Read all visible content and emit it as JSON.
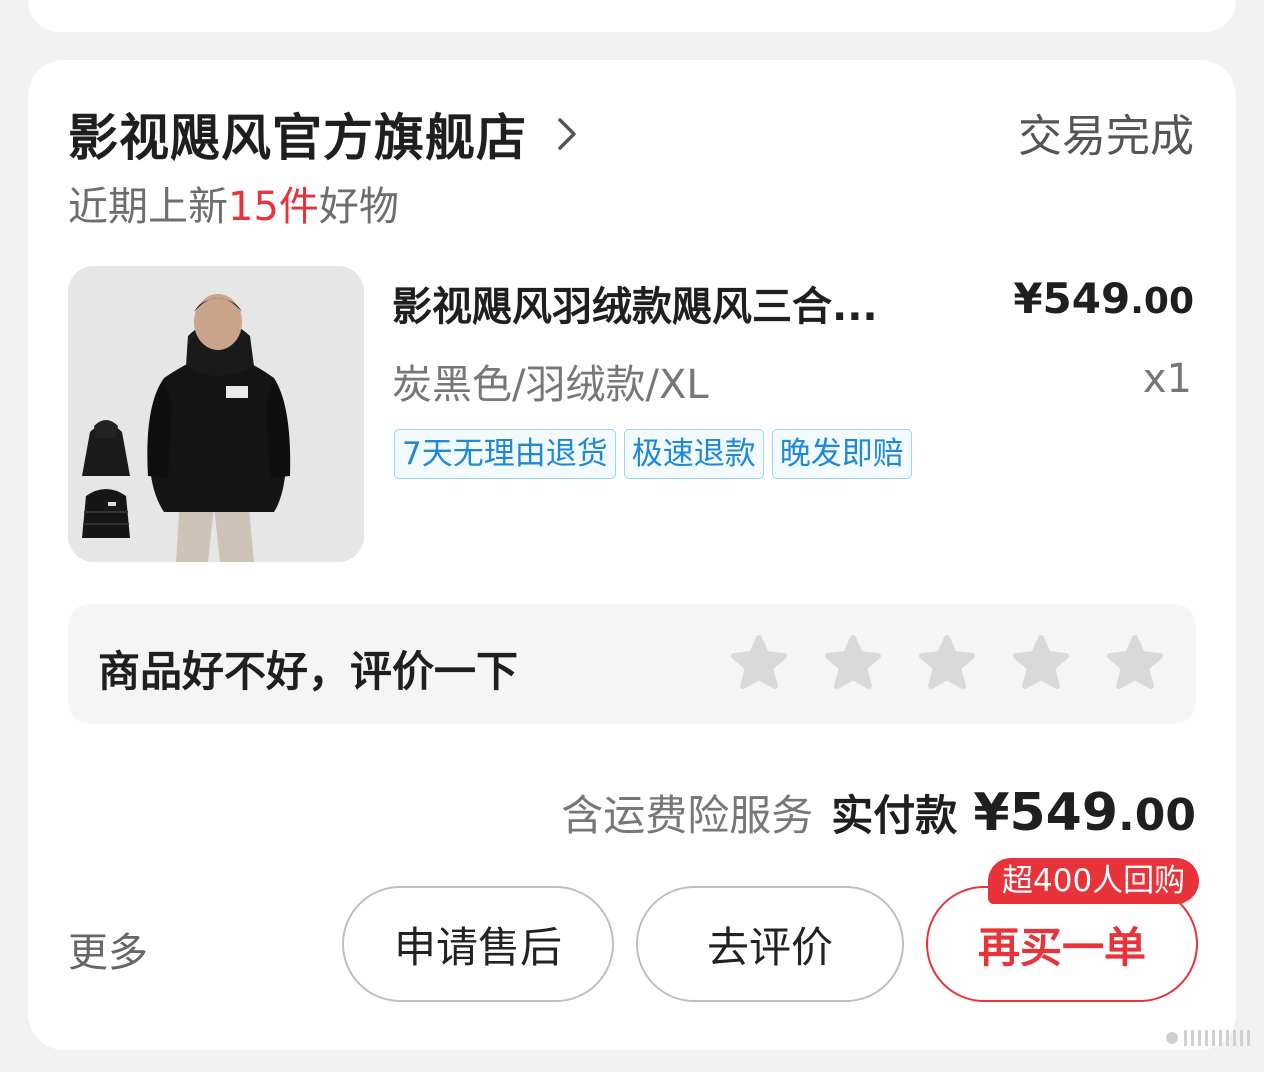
{
  "store": {
    "name": "影视飓风官方旗舰店",
    "status": "交易完成",
    "new_items_prefix": "近期上新",
    "new_items_count": "15件",
    "new_items_suffix": "好物"
  },
  "product": {
    "title": "影视飓风羽绒款飓风三合...",
    "price_main": "¥549",
    "price_cents": ".00",
    "spec": "炭黑色/羽绒款/XL",
    "quantity": "x1",
    "tags": [
      "7天无理由退货",
      "极速退款",
      "晚发即赔"
    ],
    "image_icon": "jacket-product-image"
  },
  "review": {
    "prompt": "商品好不好，评价一下",
    "stars_total": 5,
    "stars_selected": 0
  },
  "summary": {
    "insurance": "含运费险服务",
    "paid_label": "实付款",
    "total_main": "¥549",
    "total_cents": ".00"
  },
  "actions": {
    "more": "更多",
    "after_sale": "申请售后",
    "review": "去评价",
    "rebuy": "再买一单",
    "rebuy_badge": "超400人回购"
  },
  "colors": {
    "accent": "#e8333b",
    "tag_blue": "#1e88d9",
    "tag_border": "#9fd3ef"
  }
}
